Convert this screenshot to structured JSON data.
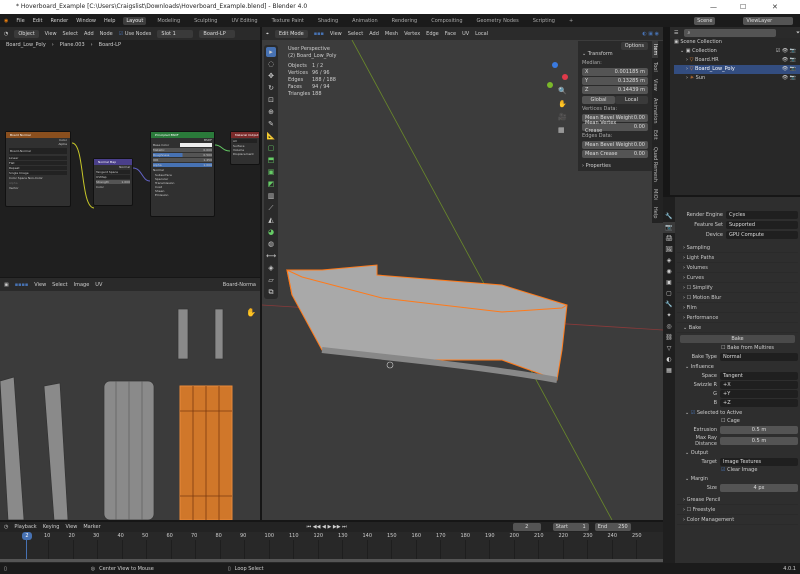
{
  "window": {
    "title": "* Hoverboard_Example [C:\\Users\\Craigslist\\Downloads\\Hoverboard_Example.blend] - Blender 4.0",
    "min": "—",
    "max": "☐",
    "close": "✕"
  },
  "menu": [
    "File",
    "Edit",
    "Render",
    "Window",
    "Help"
  ],
  "workspaces": [
    "Layout",
    "Modeling",
    "Sculpting",
    "UV Editing",
    "Texture Paint",
    "Shading",
    "Animation",
    "Rendering",
    "Compositing",
    "Geometry Nodes",
    "Scripting",
    "+"
  ],
  "scene": {
    "scene": "Scene",
    "view_layer": "ViewLayer"
  },
  "node_editor": {
    "mode": "Object",
    "menus": [
      "View",
      "Select",
      "Add",
      "Node"
    ],
    "use_nodes": "Use Nodes",
    "slot": "Slot 1",
    "material": "Board-LP",
    "breadcrumb": [
      "Board_Low_Poly",
      "Plane.003",
      "Board-LP"
    ],
    "nodes": {
      "image": {
        "title": "Board Normal",
        "outputs": [
          "Color",
          "Alpha"
        ],
        "image_name": "Board-Normal",
        "rows": [
          "Linear",
          "Flat",
          "Repeat",
          "Single Image",
          "Color Space  Non-Color",
          "Alpha"
        ],
        "input": "Vector"
      },
      "normal_map": {
        "title": "Normal Map",
        "output": "Normal",
        "space": "Tangent Space",
        "uv": "UVMap",
        "strength_label": "Strength",
        "strength": "1.000",
        "color": "Color"
      },
      "bsdf": {
        "title": "Principled BSDF",
        "output": "BSDF",
        "rows": [
          "Base Color",
          "Metallic",
          "Roughness",
          "IOR",
          "Alpha",
          "Normal",
          "Subsurface",
          "Specular",
          "Transmission",
          "Coat",
          "Sheen",
          "Emission"
        ],
        "values": [
          "",
          "0.000",
          "0.500",
          "1.450",
          "1.000"
        ]
      },
      "output": {
        "title": "Material Output",
        "target": "All",
        "inputs": [
          "Surface",
          "Volume",
          "Displacement"
        ]
      }
    }
  },
  "uv_editor": {
    "menus": [
      "View",
      "Select",
      "Image",
      "UV"
    ],
    "image": "Board-Norma"
  },
  "viewport": {
    "mode": "Edit Mode",
    "menus": [
      "View",
      "Select",
      "Add",
      "Mesh",
      "Vertex",
      "Edge",
      "Face",
      "UV"
    ],
    "orientation": "Local",
    "options": "Options",
    "overlay": {
      "title": "User Perspective",
      "object": "(2) Board_Low_Poly",
      "stats": [
        [
          "Objects",
          "1 / 2"
        ],
        [
          "Vertices",
          "96 / 96"
        ],
        [
          "Edges",
          "188 / 188"
        ],
        [
          "Faces",
          "94 / 94"
        ],
        [
          "Triangles",
          "188"
        ]
      ]
    }
  },
  "npanel": {
    "transform": "Transform",
    "median": "Median:",
    "coords": [
      [
        "X",
        "0.001185 m"
      ],
      [
        "Y",
        "0.13285 m"
      ],
      [
        "Z",
        "0.14439 m"
      ]
    ],
    "global": "Global",
    "local": "Local",
    "vertices_data": "Vertices Data:",
    "v_rows": [
      [
        "Mean Bevel Weight",
        "0.00"
      ],
      [
        "Mean Vertex Crease",
        "0.00"
      ]
    ],
    "edges_data": "Edges Data:",
    "e_rows": [
      [
        "Mean Bevel Weight",
        "0.00"
      ],
      [
        "Mean Crease",
        "0.00"
      ]
    ],
    "properties": "Properties",
    "tabs": [
      "Item",
      "Tool",
      "View",
      "Animation",
      "Edit",
      "Quad Remesh",
      "MiOi",
      "Help"
    ]
  },
  "outliner": {
    "root": "Scene Collection",
    "collection": "Collection",
    "items": [
      "Board.HR",
      "Board_Low_Poly",
      "Sun"
    ]
  },
  "properties": {
    "render_engine_label": "Render Engine",
    "render_engine": "Cycles",
    "feature_set_label": "Feature Set",
    "feature_set": "Supported",
    "device_label": "Device",
    "device": "GPU Compute",
    "sections": [
      "Sampling",
      "Light Paths",
      "Volumes",
      "Curves",
      "Simplify",
      "Motion Blur",
      "Film",
      "Performance"
    ],
    "bake": "Bake",
    "bake_button": "Bake",
    "bake_multires": "Bake from Multires",
    "bake_type_label": "Bake Type",
    "bake_type": "Normal",
    "influence": "Influence",
    "space_label": "Space",
    "space": "Tangent",
    "swizzle": [
      [
        "Swizzle R",
        "+X"
      ],
      [
        "G",
        "+Y"
      ],
      [
        "B",
        "+Z"
      ]
    ],
    "selected_to_active": "Selected to Active",
    "cage": "Cage",
    "extrusion_label": "Extrusion",
    "extrusion": "0.5 m",
    "max_ray_label": "Max Ray Distance",
    "max_ray": "0.5 m",
    "output": "Output",
    "target_label": "Target",
    "target": "Image Textures",
    "clear_image": "Clear Image",
    "margin": "Margin",
    "size_label": "Size",
    "size": "4 px",
    "bottom_sections": [
      "Grease Pencil",
      "Freestyle",
      "Color Management"
    ]
  },
  "timeline": {
    "menus": [
      "Playback",
      "Keying",
      "View",
      "Marker"
    ],
    "current_frame": "2",
    "start_label": "Start",
    "start": "1",
    "end_label": "End",
    "end": "250",
    "ticks": [
      "10",
      "20",
      "30",
      "40",
      "50",
      "60",
      "70",
      "80",
      "90",
      "100",
      "110",
      "120",
      "130",
      "140",
      "150",
      "160",
      "170",
      "180",
      "190",
      "200",
      "210",
      "220",
      "230",
      "240",
      "250"
    ]
  },
  "statusbar": {
    "center": "Center View to Mouse",
    "loop": "Loop Select",
    "version": "4.0.1"
  }
}
